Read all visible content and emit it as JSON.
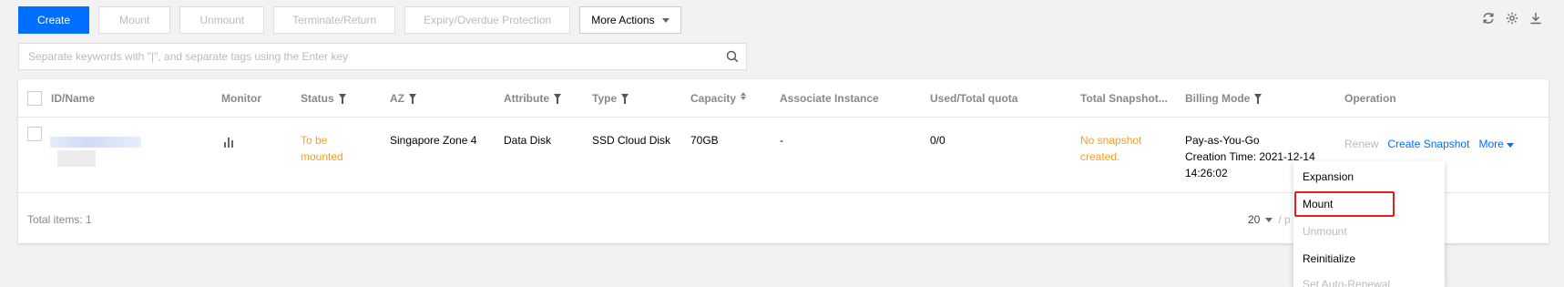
{
  "toolbar": {
    "create": "Create",
    "mount": "Mount",
    "unmount": "Unmount",
    "terminate": "Terminate/Return",
    "expiry": "Expiry/Overdue Protection",
    "more_actions": "More Actions"
  },
  "top_icons": [
    "refresh-icon",
    "settings-icon",
    "download-icon"
  ],
  "search": {
    "placeholder": "Separate keywords with \"|\", and separate tags using the Enter key"
  },
  "table": {
    "columns": {
      "id_name": "ID/Name",
      "monitor": "Monitor",
      "status": "Status",
      "az": "AZ",
      "attribute": "Attribute",
      "type": "Type",
      "capacity": "Capacity",
      "associate": "Associate Instance",
      "quota": "Used/Total quota",
      "snapshot": "Total Snapshot...",
      "billing": "Billing Mode",
      "operation": "Operation"
    },
    "row": {
      "status_line1": "To be",
      "status_line2": "mounted",
      "az": "Singapore Zone 4",
      "attribute": "Data Disk",
      "type": "SSD Cloud Disk",
      "capacity": "70GB",
      "associate": "-",
      "quota": "0/0",
      "snapshot_line1": "No snapshot",
      "snapshot_line2": "created.",
      "billing_line1": "Pay-as-You-Go",
      "billing_line2": "Creation Time: 2021-12-14",
      "billing_line3": "14:26:02",
      "op_renew": "Renew",
      "op_create_snapshot": "Create Snapshot",
      "op_more": "More"
    }
  },
  "footer": {
    "total": "Total items:  1",
    "page_size": "20",
    "per_page": "/ p"
  },
  "dropdown": {
    "expansion": "Expansion",
    "mount": "Mount",
    "unmount": "Unmount",
    "reinitialize": "Reinitialize",
    "auto_renewal": "Set Auto-Renewal"
  },
  "colors": {
    "primary": "#006eff",
    "warning": "#ff9c19",
    "highlight": "#e02020"
  }
}
